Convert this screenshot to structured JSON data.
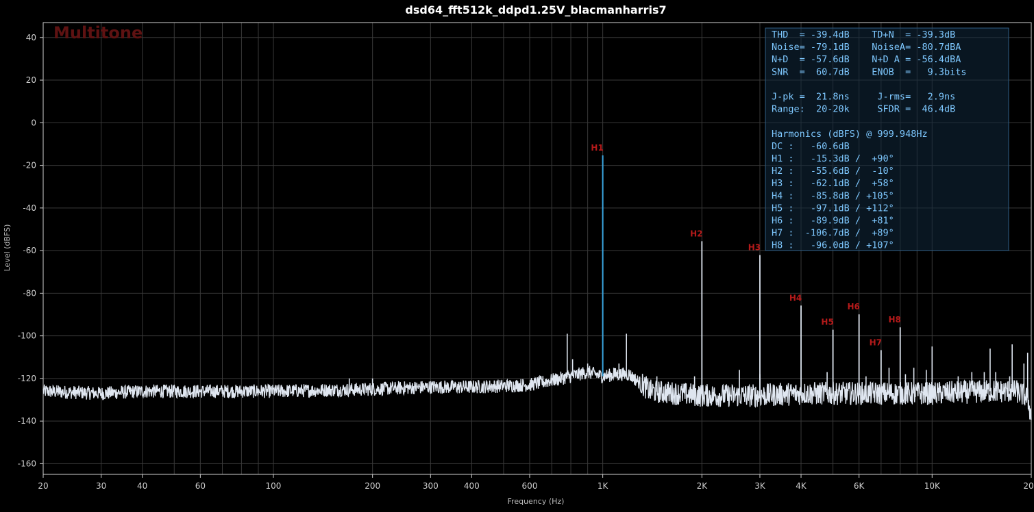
{
  "watermark": "Multitone",
  "colors": {
    "background": "#000000",
    "grid": "#3a3a3a",
    "noise_trace": "#dfe6f0",
    "fundamental": "#3aa6e0",
    "harmonic_label": "#b51a1a",
    "stats_text": "#7ec8ff",
    "stats_box": "#1a3a55"
  },
  "chart_data": {
    "type": "line",
    "title": "dsd64_fft512k_ddpd1.25V_blacmanharris7",
    "xlabel": "Frequency (Hz)",
    "ylabel": "Level (dBFS)",
    "x_scale": "log",
    "xlim": [
      20,
      20000
    ],
    "ylim": [
      -165,
      47
    ],
    "grid": true,
    "x_ticks": [
      {
        "value": 20,
        "label": "20"
      },
      {
        "value": 30,
        "label": "30"
      },
      {
        "value": 40,
        "label": "40"
      },
      {
        "value": 60,
        "label": "60"
      },
      {
        "value": 100,
        "label": "100"
      },
      {
        "value": 200,
        "label": "200"
      },
      {
        "value": 300,
        "label": "300"
      },
      {
        "value": 400,
        "label": "400"
      },
      {
        "value": 600,
        "label": "600"
      },
      {
        "value": 1000,
        "label": "1K"
      },
      {
        "value": 2000,
        "label": "2K"
      },
      {
        "value": 3000,
        "label": "3K"
      },
      {
        "value": 4000,
        "label": "4K"
      },
      {
        "value": 6000,
        "label": "6K"
      },
      {
        "value": 10000,
        "label": "10K"
      },
      {
        "value": 20000,
        "label": "20K"
      }
    ],
    "y_ticks": [
      40,
      20,
      0,
      -20,
      -40,
      -60,
      -80,
      -100,
      -120,
      -140,
      -160
    ],
    "noise_floor": [
      [
        20,
        -126
      ],
      [
        30,
        -127
      ],
      [
        40,
        -126
      ],
      [
        60,
        -126
      ],
      [
        100,
        -126
      ],
      [
        200,
        -125
      ],
      [
        300,
        -124
      ],
      [
        400,
        -124
      ],
      [
        600,
        -123
      ],
      [
        800,
        -119
      ],
      [
        900,
        -117
      ],
      [
        1000,
        -119
      ],
      [
        1100,
        -118
      ],
      [
        1200,
        -118
      ],
      [
        1400,
        -126
      ],
      [
        2000,
        -128
      ],
      [
        3000,
        -128
      ],
      [
        4000,
        -127
      ],
      [
        6000,
        -127
      ],
      [
        10000,
        -127
      ],
      [
        15000,
        -126
      ],
      [
        18000,
        -126
      ],
      [
        19500,
        -129
      ],
      [
        20000,
        -138
      ]
    ],
    "spurs": [
      [
        170,
        -120
      ],
      [
        200,
        -120
      ],
      [
        640,
        -120
      ],
      [
        780,
        -99
      ],
      [
        810,
        -111
      ],
      [
        900,
        -113
      ],
      [
        950,
        -117
      ],
      [
        1080,
        -115
      ],
      [
        1120,
        -113
      ],
      [
        1180,
        -99
      ],
      [
        1320,
        -120
      ],
      [
        1460,
        -119
      ],
      [
        1900,
        -119
      ],
      [
        2600,
        -116
      ],
      [
        3000,
        -118
      ],
      [
        4800,
        -117
      ],
      [
        6300,
        -119
      ],
      [
        7400,
        -115
      ],
      [
        8300,
        -118
      ],
      [
        8800,
        -115
      ],
      [
        9600,
        -116
      ],
      [
        12000,
        -119
      ],
      [
        13200,
        -117
      ],
      [
        14400,
        -117
      ],
      [
        15600,
        -117
      ],
      [
        17200,
        -119
      ],
      [
        19000,
        -113
      ]
    ],
    "harmonics": [
      {
        "label": "H1",
        "freq": 1000,
        "level": -15.3
      },
      {
        "label": "H2",
        "freq": 2000,
        "level": -55.6
      },
      {
        "label": "H3",
        "freq": 3000,
        "level": -62.1
      },
      {
        "label": "H4",
        "freq": 4000,
        "level": -85.8
      },
      {
        "label": "H5",
        "freq": 5000,
        "level": -97.1
      },
      {
        "label": "H6",
        "freq": 6000,
        "level": -89.9
      },
      {
        "label": "H7",
        "freq": 7000,
        "level": -106.7
      },
      {
        "label": "H8",
        "freq": 8000,
        "level": -96.0
      }
    ],
    "extra_peaks": [
      [
        10000,
        -105
      ],
      [
        15000,
        -106
      ],
      [
        17500,
        -104
      ],
      [
        19500,
        -108
      ]
    ]
  },
  "stats_lines": [
    "THD  = -39.4dB    TD+N  = -39.3dB",
    "Noise= -79.1dB    NoiseA= -80.7dBA",
    "N+D  = -57.6dB    N+D A = -56.4dBA",
    "SNR  =  60.7dB    ENOB  =   9.3bits",
    "",
    "J-pk =  21.8ns     J-rms=   2.9ns",
    "Range:  20-20k     SFDR =  46.4dB",
    "",
    "Harmonics (dBFS) @ 999.948Hz",
    "DC :   -60.6dB",
    "H1 :   -15.3dB /  +90°",
    "H2 :   -55.6dB /  -10°",
    "H3 :   -62.1dB /  +58°",
    "H4 :   -85.8dB / +105°",
    "H5 :   -97.1dB / +112°",
    "H6 :   -89.9dB /  +81°",
    "H7 :  -106.7dB /  +89°",
    "H8 :   -96.0dB / +107°"
  ]
}
